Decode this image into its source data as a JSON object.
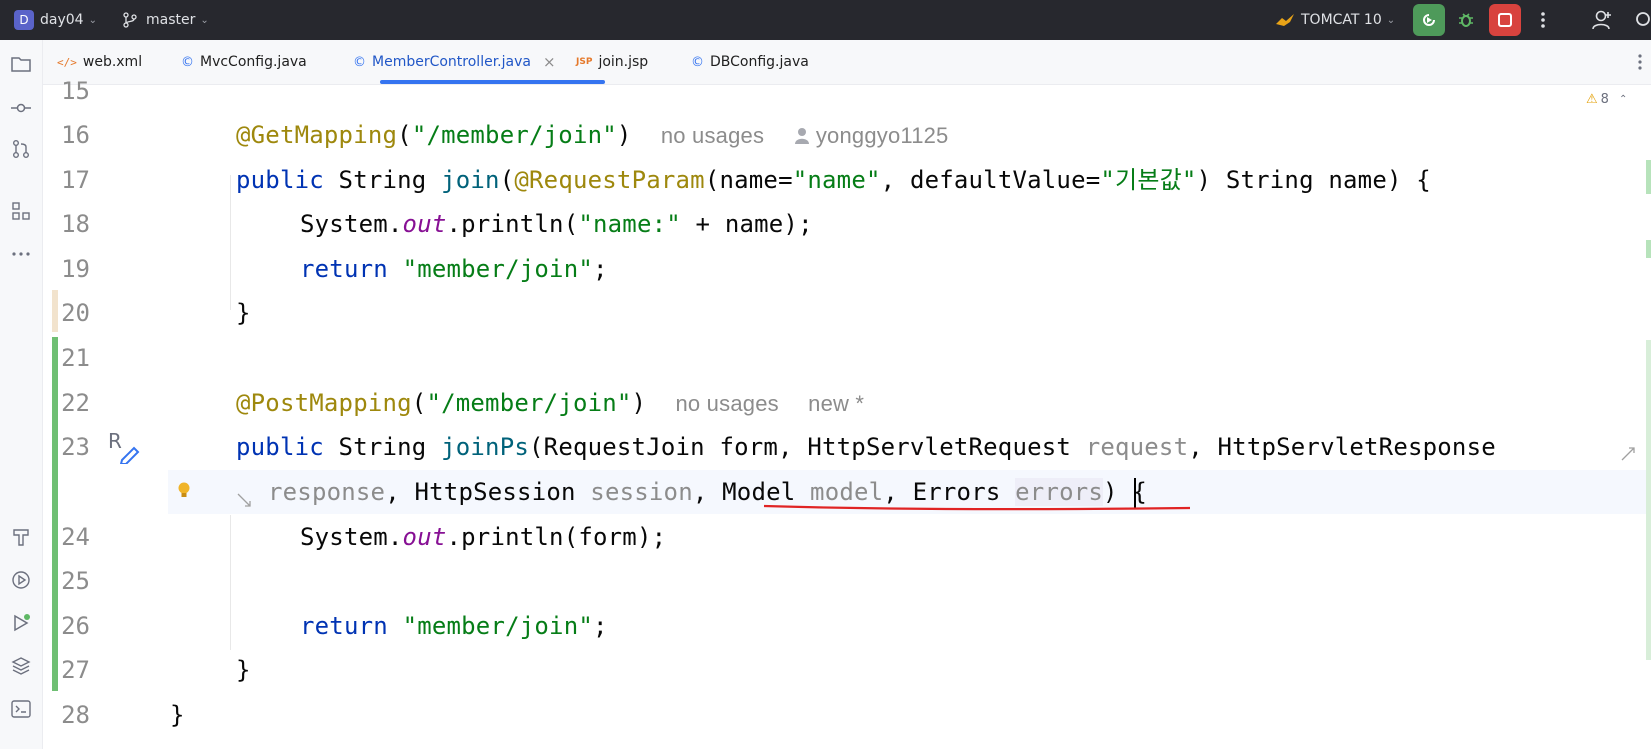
{
  "titlebar": {
    "project_badge": "D",
    "project_name": "day04",
    "branch": "master",
    "run_config": "TOMCAT 10",
    "icons": [
      "branch-icon",
      "tomcat-icon",
      "run-icon",
      "debug-icon",
      "stop-icon",
      "more-icon",
      "account-icon",
      "search-icon"
    ]
  },
  "tabs": [
    {
      "label": "web.xml",
      "icon": "xml-icon",
      "glyph": "</>",
      "color": "#e5792b"
    },
    {
      "label": "MvcConfig.java",
      "icon": "java-class-icon",
      "glyph": "©",
      "color": "#3574f0"
    },
    {
      "label": "MemberController.java",
      "icon": "java-class-icon",
      "glyph": "©",
      "color": "#3574f0",
      "active": true,
      "close": "×"
    },
    {
      "label": "join.jsp",
      "icon": "jsp-icon",
      "glyph": "JSP",
      "color": "#e5792b"
    },
    {
      "label": "DBConfig.java",
      "icon": "java-class-icon",
      "glyph": "©",
      "color": "#3574f0"
    }
  ],
  "editor": {
    "warnings_count": "8",
    "warning_icon": "⚠",
    "line_numbers": [
      "15",
      "16",
      "17",
      "18",
      "19",
      "20",
      "21",
      "22",
      "23",
      "24",
      "25",
      "26",
      "27",
      "28"
    ],
    "hints": {
      "line16_usages": "no usages",
      "line16_author": "yonggyo1125",
      "line22_usages": "no usages",
      "line22_new": "new *"
    }
  },
  "leftbar_icons": [
    "project-icon",
    "commit-icon",
    "pull-requests-icon",
    "structure-icon",
    "more-icon",
    "build-icon",
    "services-icon",
    "run-icon",
    "layers-icon",
    "terminal-icon"
  ]
}
